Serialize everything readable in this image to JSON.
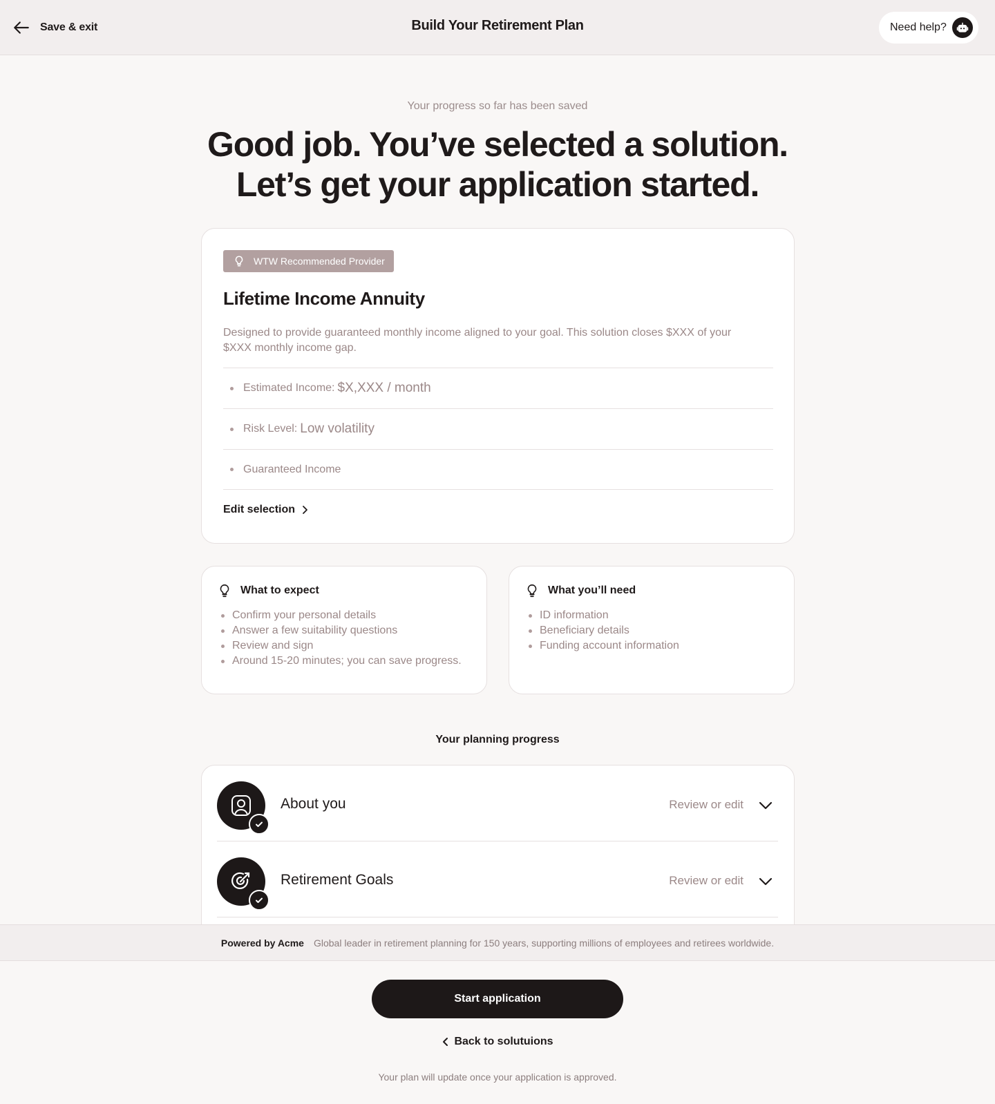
{
  "header": {
    "save_exit_label": "Save & exit",
    "title": "Build Your Retirement Plan",
    "help_label": "Need help?"
  },
  "hero": {
    "saved_note": "Your progress so far has been saved",
    "headline_line1": "Good job. You’ve selected a solution.",
    "headline_line2": "Let’s get your application started."
  },
  "selection": {
    "badge": "WTW Recommended Provider",
    "title": "Lifetime Income Annuity",
    "description": "Designed to provide guaranteed monthly income aligned to your goal. This solution closes $XXX of your $XXX monthly income gap.",
    "features": [
      {
        "label": "Estimated Income:",
        "value": "$X,XXX / month"
      },
      {
        "label": "Risk Level:",
        "value": "Low volatility"
      },
      {
        "label": "Guaranteed Income",
        "value": ""
      }
    ],
    "edit_label": "Edit selection"
  },
  "expect": {
    "title": "What to expect",
    "items": [
      "Confirm your personal details",
      "Answer a few suitability questions",
      "Review and sign",
      "Around 15-20 minutes; you can save progress."
    ]
  },
  "need": {
    "title": "What you’ll need",
    "items": [
      "ID information",
      "Beneficiary details",
      "Funding account information"
    ]
  },
  "progress": {
    "title": "Your planning progress",
    "steps": [
      {
        "label": "About you",
        "action": "Review or edit",
        "icon": "user-portrait-icon",
        "status": "complete"
      },
      {
        "label": "Retirement Goals",
        "action": "Review or edit",
        "icon": "target-icon",
        "status": "complete"
      }
    ]
  },
  "footer": {
    "powered_brand": "Powered by Acme",
    "powered_text": "Global leader in retirement planning for 150 years, supporting millions of employees and retirees worldwide.",
    "start_label": "Start application",
    "back_label": "Back to solutuions",
    "footnote": "Your plan will update once your application is approved."
  },
  "colors": {
    "accent_dark": "#1d1818",
    "badge_bg": "#b2a0a0",
    "muted_text": "#9b8888",
    "header_bg": "#f2eeee"
  }
}
